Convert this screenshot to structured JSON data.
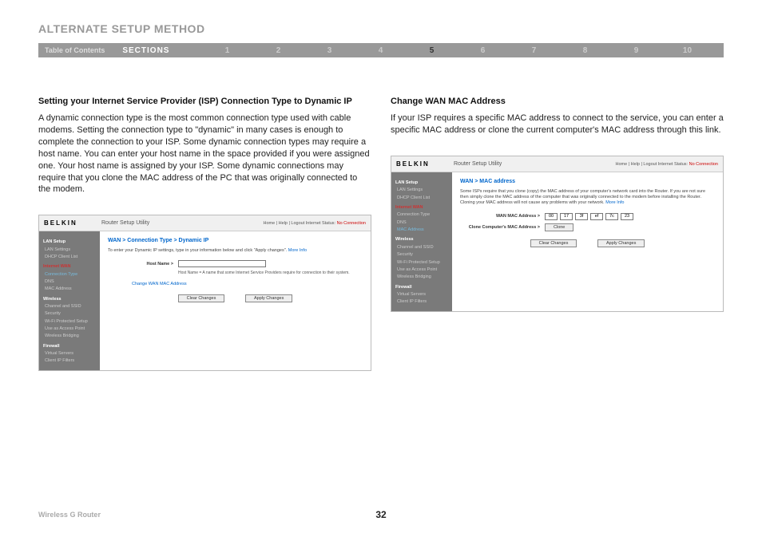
{
  "page_title": "ALTERNATE SETUP METHOD",
  "nav": {
    "toc": "Table of Contents",
    "sections": "SECTIONS",
    "items": [
      "1",
      "2",
      "3",
      "4",
      "5",
      "6",
      "7",
      "8",
      "9",
      "10"
    ],
    "active": "5"
  },
  "left": {
    "heading": "Setting your Internet Service Provider (ISP) Connection Type to Dynamic IP",
    "body": "A dynamic connection type is the most common connection type used with cable modems. Setting the connection type to \"dynamic\" in many cases is enough to complete the connection to your ISP. Some dynamic connection types may require a host name. You can enter your host name in the space provided if you were assigned one. Your host name is assigned by your ISP. Some dynamic connections may require that you clone the MAC address of the PC that was originally connected to the modem."
  },
  "right": {
    "heading": "Change WAN MAC Address",
    "body": "If your ISP requires a specific MAC address to connect to the service, you can enter a specific MAC address or clone the current computer's MAC address through this link."
  },
  "panel_common": {
    "brand": "BELKIN",
    "title": "Router Setup Utility",
    "top_links": "Home | Help | Logout   Internet Status:",
    "status": "No Connection"
  },
  "panel_left": {
    "crumb": "WAN > Connection Type > Dynamic IP",
    "desc": "To enter your Dynamic IP settings, type in your information below and click \"Apply changes\".",
    "more": "More Info",
    "hostname_label": "Host Name >",
    "hostname_hint": "Host Name = A name that some Internet Service Providers require for connection to their system.",
    "change_mac": "Change WAN MAC Address",
    "clear": "Clear Changes",
    "apply": "Apply Changes",
    "sidebar": {
      "g1": "LAN Setup",
      "g1a": "LAN Settings",
      "g1b": "DHCP Client List",
      "g2": "Internet WAN",
      "g2a": "Connection Type",
      "g2b": "DNS",
      "g2c": "MAC Address",
      "g3": "Wireless",
      "g3a": "Channel and SSID",
      "g3b": "Security",
      "g3c": "Wi-Fi Protected Setup",
      "g3d": "Use as Access Point",
      "g3e": "Wireless Bridging",
      "g4": "Firewall",
      "g4a": "Virtual Servers",
      "g4b": "Client IP Filters"
    }
  },
  "panel_right": {
    "crumb": "WAN > MAC address",
    "desc": "Some ISPs require that you clone (copy) the MAC address of your computer's network card into the Router. If you are not sure then simply clone the MAC address of the computer that was originally connected to the modem before installing the Router. Cloning your MAC address will not cause any problems with your network.",
    "more": "More Info",
    "wan_mac_label": "WAN MAC Address >",
    "mac": [
      "00",
      "17",
      "3f",
      "ef",
      "7c",
      "23"
    ],
    "clone_label": "Clone Computer's MAC Address >",
    "clone_btn": "Clone",
    "clear": "Clear Changes",
    "apply": "Apply Changes",
    "sidebar": {
      "g1": "LAN Setup",
      "g1a": "LAN Settings",
      "g1b": "DHCP Client List",
      "g2": "Internet WAN",
      "g2a": "Connection Type",
      "g2b": "DNS",
      "g2c": "MAC Address",
      "g3": "Wireless",
      "g3a": "Channel and SSID",
      "g3b": "Security",
      "g3c": "Wi-Fi Protected Setup",
      "g3d": "Use as Access Point",
      "g3e": "Wireless Bridging",
      "g4": "Firewall",
      "g4a": "Virtual Servers",
      "g4b": "Client IP Filters"
    }
  },
  "footer": {
    "product": "Wireless G Router",
    "page": "32"
  }
}
